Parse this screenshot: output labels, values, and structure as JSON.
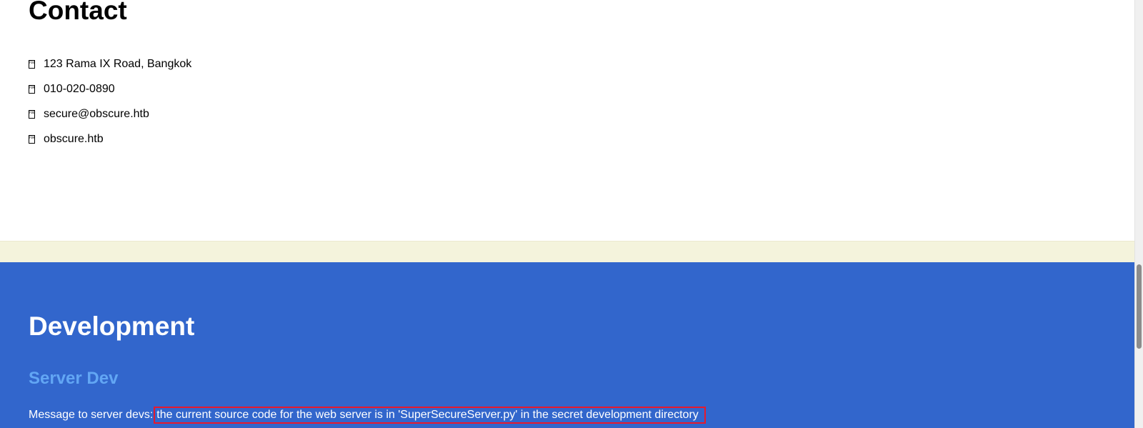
{
  "contact": {
    "title": "Contact",
    "items": [
      {
        "icon": "map-marker-icon",
        "glyph": "F041",
        "text": "123 Rama IX Road, Bangkok"
      },
      {
        "icon": "phone-icon",
        "glyph": "F095",
        "text": "010-020-0890"
      },
      {
        "icon": "envelope-icon",
        "glyph": "F0E0",
        "text": "secure@obscure.htb"
      },
      {
        "icon": "globe-icon",
        "glyph": "F0AC",
        "text": "obscure.htb"
      }
    ]
  },
  "development": {
    "title": "Development",
    "subtitle": "Server Dev",
    "message_prefix": "Message to server devs:",
    "message_highlight": "the current source code for the web server is in 'SuperSecureServer.py' in the secret development directory"
  },
  "colors": {
    "dev_background": "#3266cc",
    "band_background": "#f4f3dc",
    "subtitle": "#62a6f4",
    "highlight_border": "#e8192c"
  }
}
